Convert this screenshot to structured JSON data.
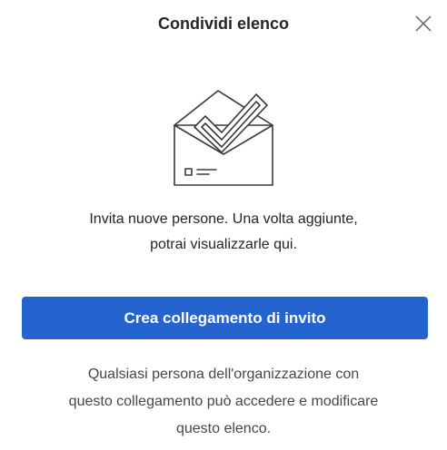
{
  "dialog": {
    "title": "Condividi elenco",
    "close_icon": "close-icon"
  },
  "illustration": {
    "icon": "envelope-checkmark-icon"
  },
  "message": {
    "line1": "Invita nuove persone. Una volta aggiunte,",
    "line2": "potrai visualizzarle qui."
  },
  "primary_action": {
    "label": "Crea collegamento di invito",
    "color": "#2564cf"
  },
  "footnote": {
    "line1": "Qualsiasi persona dell'organizzazione con",
    "line2": "questo collegamento può accedere e modificare",
    "line3": "questo elenco."
  }
}
